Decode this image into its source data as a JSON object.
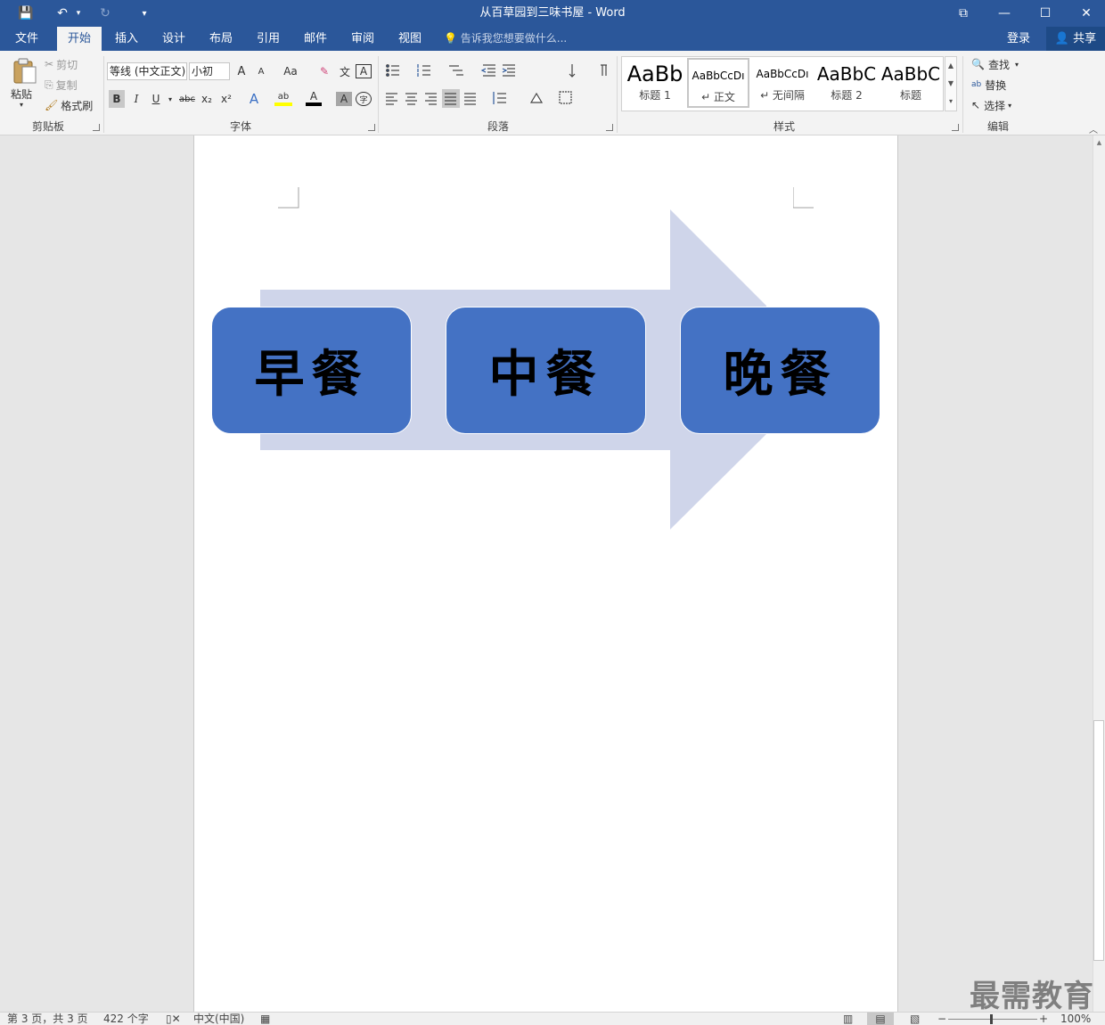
{
  "window": {
    "title": "从百草园到三味书屋 - Word",
    "controls": {
      "ribbon_display": "⧉",
      "minimize": "—",
      "maximize": "☐",
      "close": "✕"
    }
  },
  "quick_access": {
    "save": "💾",
    "undo": "↶",
    "undo_dropdown": "▾",
    "redo": "↻",
    "customize": "▾"
  },
  "tabs": [
    {
      "label": "文件",
      "active": false
    },
    {
      "label": "开始",
      "active": true
    },
    {
      "label": "插入",
      "active": false
    },
    {
      "label": "设计",
      "active": false
    },
    {
      "label": "布局",
      "active": false
    },
    {
      "label": "引用",
      "active": false
    },
    {
      "label": "邮件",
      "active": false
    },
    {
      "label": "审阅",
      "active": false
    },
    {
      "label": "视图",
      "active": false
    }
  ],
  "tell_me": {
    "icon": "💡",
    "placeholder": "告诉我您想要做什么..."
  },
  "account": {
    "login": "登录",
    "share_icon": "👤",
    "share": "共享"
  },
  "clipboard": {
    "paste": "粘贴",
    "cut": "剪切",
    "copy": "复制",
    "format_painter": "格式刷",
    "label": "剪贴板"
  },
  "font": {
    "font_name": "等线 (中文正文)",
    "font_size": "小初",
    "label": "字体",
    "buttons": {
      "grow": "A",
      "shrink": "A",
      "case": "Aa",
      "clear": "✎",
      "phonetic": "文",
      "border": "A",
      "bold": "B",
      "italic": "I",
      "underline": "U",
      "strike": "abc",
      "sub": "x₂",
      "sup": "x²",
      "effects": "A",
      "highlight": "ab",
      "color": "A",
      "shade": "A",
      "enclose": "字"
    }
  },
  "paragraph": {
    "label": "段落"
  },
  "styles": {
    "label": "样式",
    "items": [
      {
        "preview": "AaBb",
        "name": "标题 1",
        "selected": false
      },
      {
        "preview": "AaBbCcDı",
        "name": "↵ 正文",
        "selected": true
      },
      {
        "preview": "AaBbCcDı",
        "name": "↵ 无间隔",
        "selected": false
      },
      {
        "preview": "AaBbC",
        "name": "标题 2",
        "selected": false
      },
      {
        "preview": "AaBbC",
        "name": "标题",
        "selected": false
      }
    ]
  },
  "editing": {
    "find": "查找",
    "replace": "替换",
    "select": "选择",
    "label": "编辑"
  },
  "smartart": {
    "items": [
      "早餐",
      "中餐",
      "晚餐"
    ],
    "arrow_color": "#cfd5ea",
    "box_color": "#4472c4"
  },
  "status": {
    "page": "第 3 页，共 3 页",
    "words": "422 个字",
    "language": "中文(中国)",
    "zoom": "100%"
  },
  "watermark": "最需教育"
}
